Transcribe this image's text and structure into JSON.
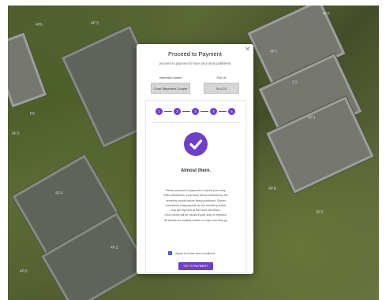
{
  "map": {
    "plot_labels": [
      "4Ph",
      "4P.S",
      "4P.F",
      "4P.7",
      "2.5",
      "4P.1",
      "4P.3",
      "4P.4",
      "Ph",
      "4P.2",
      "4P.8",
      "4P.5",
      "4P.6"
    ]
  },
  "modal": {
    "close_symbol": "✕",
    "title": "Proceed to Payment",
    "subtitle": "proceed to payment to have your story published",
    "interment_name_label": "Interment Name",
    "interment_name_value": "Coral Stephanie Cooper",
    "plot_id_label": "Plot ID",
    "plot_id_value": "M-4-23",
    "steps": [
      "1",
      "2",
      "3",
      "4",
      "5"
    ],
    "check_icon": "check-circle-icon",
    "heading": "Almost there.",
    "body_lines": [
      "Please proceed to payment to submit your story.",
      "After submission, your story will be reviewed by the",
      "cemetery admin before being published. Stories",
      "considered inappropriate by the cemetery admin",
      "may get rejected at their sole discretion.",
      "A full refund will be issued if your story is rejected.",
      "All stories are publicly visible on map once they go"
    ],
    "terms_label": "Agree to terms and conditions",
    "terms_checked": true,
    "pay_button_label": "GO TO PAYMENT"
  },
  "colors": {
    "accent": "#6f3fc8",
    "checkbox": "#3b57b8"
  }
}
